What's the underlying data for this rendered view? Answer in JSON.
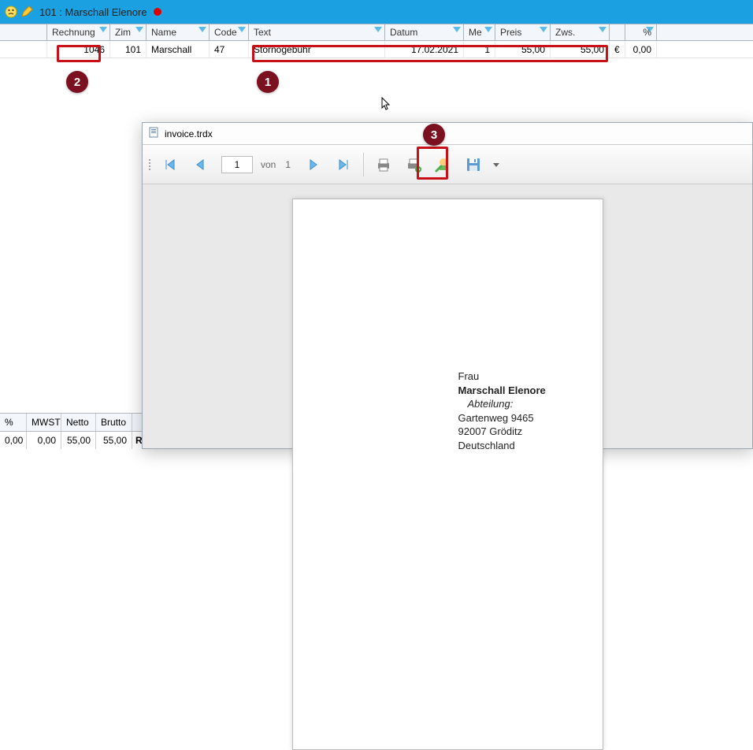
{
  "window": {
    "tab_text": "101 :  Marschall Elenore"
  },
  "grid": {
    "headers": {
      "rechnung": "Rechnung",
      "zim": "Zim",
      "name": "Name",
      "code": "Code",
      "text": "Text",
      "datum": "Datum",
      "me": "Me",
      "preis": "Preis",
      "zws": "Zws.",
      "percent": "%"
    },
    "rows": [
      {
        "rechnung": "1046",
        "zim": "101",
        "name": "Marschall",
        "code": "47",
        "text": "Stornogebühr",
        "datum": "17.02.2021",
        "me": "1",
        "preis": "55,00",
        "zws": "55,00",
        "currency": "€",
        "percent": "0,00"
      }
    ]
  },
  "callouts": {
    "c1": "1",
    "c2": "2",
    "c3": "3"
  },
  "viewer": {
    "title": "invoice.trdx",
    "page_current": "1",
    "page_of_label": "von",
    "page_total": "1",
    "address": {
      "salutation": "Frau",
      "name": "Marschall Elenore",
      "department_label": "Abteilung:",
      "street": "Gartenweg 9465",
      "city": "92007 Gröditz",
      "country": "Deutschland"
    }
  },
  "totals": {
    "headers": {
      "percent": "%",
      "mwst": "MWST",
      "netto": "Netto",
      "brutto": "Brutto"
    },
    "row": {
      "percent": "0,00",
      "mwst": "0,00",
      "netto": "55,00",
      "brutto": "55,00"
    },
    "rest_label": "Res"
  }
}
